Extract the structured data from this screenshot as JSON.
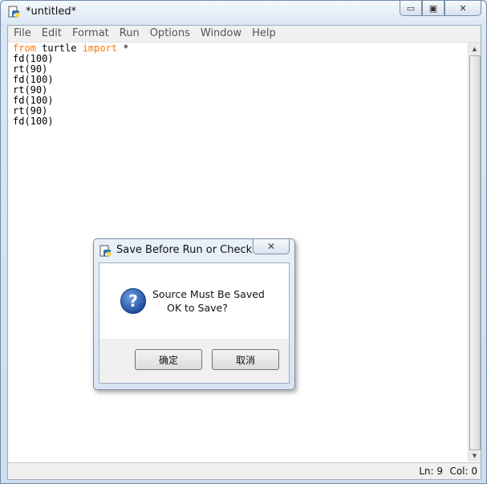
{
  "window": {
    "title": "*untitled*",
    "controls": {
      "minimize": "▭",
      "restore": "▣",
      "close": "✕"
    }
  },
  "menu": [
    "File",
    "Edit",
    "Format",
    "Run",
    "Options",
    "Window",
    "Help"
  ],
  "editor": {
    "lines": [
      [
        {
          "t": "from",
          "kw": true
        },
        {
          "t": " turtle ",
          "kw": false
        },
        {
          "t": "import",
          "kw": true
        },
        {
          "t": " *",
          "kw": false
        }
      ],
      [
        {
          "t": "fd(100)",
          "kw": false
        }
      ],
      [
        {
          "t": "rt(90)",
          "kw": false
        }
      ],
      [
        {
          "t": "fd(100)",
          "kw": false
        }
      ],
      [
        {
          "t": "rt(90)",
          "kw": false
        }
      ],
      [
        {
          "t": "fd(100)",
          "kw": false
        }
      ],
      [
        {
          "t": "rt(90)",
          "kw": false
        }
      ],
      [
        {
          "t": "fd(100)",
          "kw": false
        }
      ]
    ]
  },
  "status": {
    "ln": "Ln: 9",
    "col": "Col: 0"
  },
  "dialog": {
    "title": "Save Before Run or Check",
    "line1": "Source Must Be Saved",
    "line2": "OK to Save?",
    "ok_label": "确定",
    "cancel_label": "取消",
    "close_glyph": "✕"
  },
  "icons": {
    "app": "python-idle-icon",
    "question": "question-icon"
  },
  "colors": {
    "keyword": "#ff7700",
    "question_blue": "#2a5db0"
  }
}
